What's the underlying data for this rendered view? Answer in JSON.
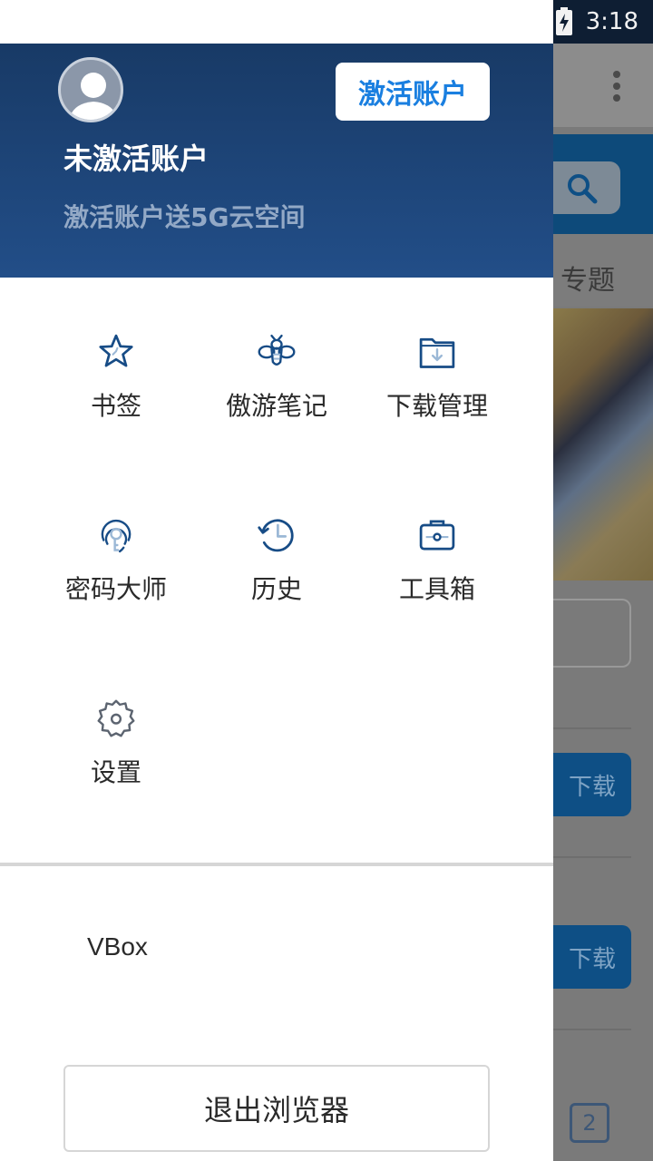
{
  "status_bar": {
    "time": "3:18",
    "icons": [
      "wifi-icon",
      "no-sim-icon",
      "battery-charging-icon"
    ]
  },
  "drawer": {
    "header": {
      "avatar_icon": "user-avatar-icon",
      "activate_label": "激活账户",
      "account_status": "未激活账户",
      "promo_text": "激活账户送5G云空间",
      "colors": {
        "header_top": "#183a66",
        "header_bottom": "#224e88",
        "accent": "#1a7fe0"
      }
    },
    "menu": [
      {
        "label": "书签",
        "icon": "star-icon"
      },
      {
        "label": "傲游笔记",
        "icon": "bee-icon"
      },
      {
        "label": "下载管理",
        "icon": "download-folder-icon"
      },
      {
        "label": "密码大师",
        "icon": "fingerprint-key-icon"
      },
      {
        "label": "历史",
        "icon": "history-clock-icon"
      },
      {
        "label": "工具箱",
        "icon": "toolbox-icon"
      },
      {
        "label": "设置",
        "icon": "gear-icon"
      }
    ],
    "vbox_label": "VBox",
    "exit_label": "退出浏览器"
  },
  "background_page": {
    "tab_label": "专题",
    "download_label": "下载",
    "download_label_2": "下载",
    "tabs_count": "2"
  }
}
